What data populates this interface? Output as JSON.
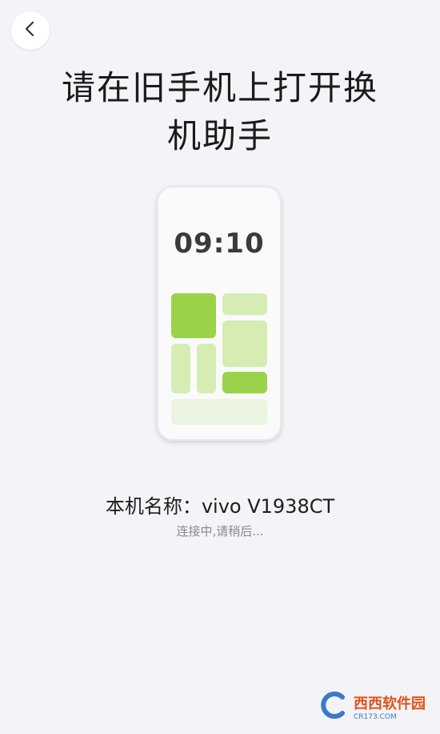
{
  "header": {
    "back_icon": "chevron-left-icon"
  },
  "title": {
    "line1": "请在旧手机上打开换",
    "line2": "机助手"
  },
  "phone_illustration": {
    "time": "09:10",
    "colors": {
      "dark_green": "#9ad34a",
      "light_green": "#d5ecb3",
      "pale_green": "#eaf4de"
    }
  },
  "device": {
    "name_label": "本机名称：vivo V1938CT"
  },
  "status": {
    "text": "连接中,请稍后..."
  },
  "watermark": {
    "text": "西西软件园",
    "sub": "CR173.COM"
  }
}
